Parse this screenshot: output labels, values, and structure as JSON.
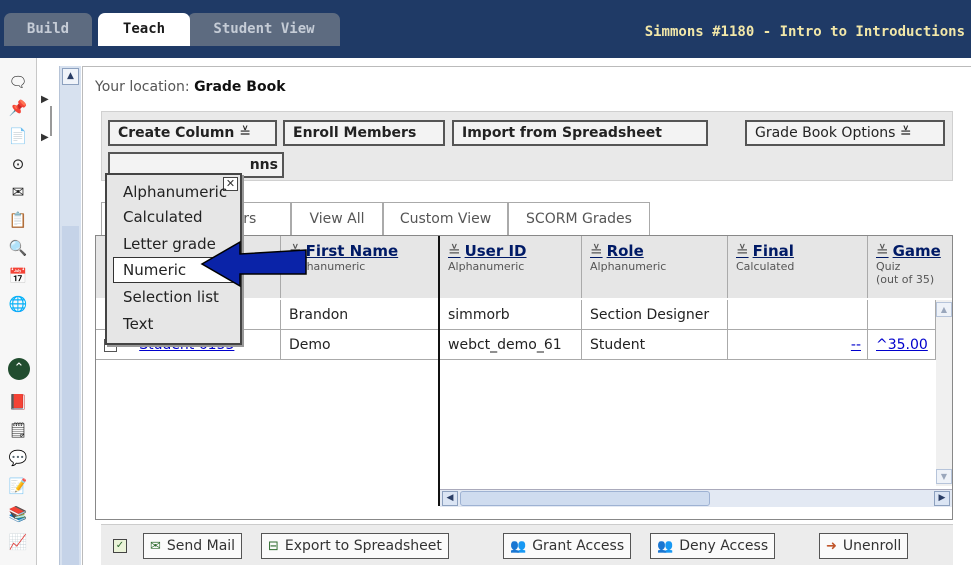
{
  "top_tabs": [
    "Build",
    "Teach",
    "Student View"
  ],
  "course_title": "Simmons #1180 - Intro to Introductions",
  "location": {
    "label": "Your location:",
    "value": "Grade Book"
  },
  "toolbar": {
    "create_column": "Create Column",
    "enroll_members": "Enroll Members",
    "import_spreadsheet": "Import from Spreadsheet",
    "grade_book_options": "Grade Book Options",
    "columns_fragment": "nns"
  },
  "view_tabs": [
    "bers",
    "View All",
    "Custom View",
    "SCORM Grades"
  ],
  "dropdown": {
    "items": [
      "Alphanumeric",
      "Calculated",
      "Letter grade",
      "Numeric",
      "Selection list",
      "Text"
    ],
    "selected": "Numeric"
  },
  "columns": [
    {
      "name": "First Name",
      "type": "Alphanumeric"
    },
    {
      "name": "User ID",
      "type": "Alphanumeric"
    },
    {
      "name": "Role",
      "type": "Alphanumeric"
    },
    {
      "name": "Final",
      "type": "Calculated"
    },
    {
      "name": "Game",
      "type": "Quiz",
      "type2": "(out of 35)"
    }
  ],
  "rows": [
    {
      "student": "",
      "first_name": "Brandon",
      "user_id": "simmorb",
      "role": "Section Designer",
      "final": "",
      "game": ""
    },
    {
      "student": "Student 6153",
      "first_name": "Demo",
      "user_id": "webct_demo_61",
      "role": "Student",
      "final": "--",
      "game": "^35.00"
    }
  ],
  "footer": {
    "send_mail": "Send Mail",
    "export": "Export to Spreadsheet",
    "grant": "Grant Access",
    "deny": "Deny Access",
    "unenroll": "Unenroll"
  },
  "colors": {
    "header_bar": "#1f3a66",
    "title_text": "#f2e7a8",
    "arrow": "#0a23a8"
  }
}
